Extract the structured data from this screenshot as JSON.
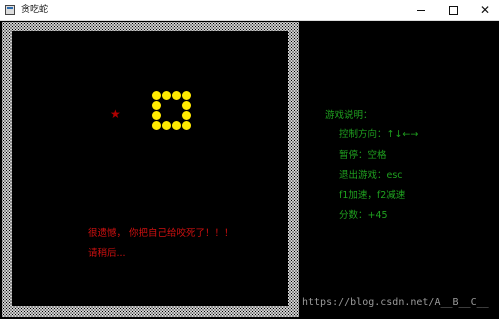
{
  "window": {
    "title": "贪吃蛇"
  },
  "game": {
    "message_line1": "很遗憾， 你把自己给咬死了！！！",
    "message_line2": "请稍后...",
    "food_glyph": "★",
    "snake_color": "#ffea00",
    "food_color": "#b00000",
    "wall_color": "#ffffff"
  },
  "info": {
    "title": "游戏说明：",
    "direction": "控制方向：↑↓←→",
    "pause": "暂停：空格",
    "exit": "退出游戏：esc",
    "speed": "f1加速，f2减速",
    "score": "分数：+45"
  },
  "watermark": "https://blog.csdn.net/A__B__C__"
}
